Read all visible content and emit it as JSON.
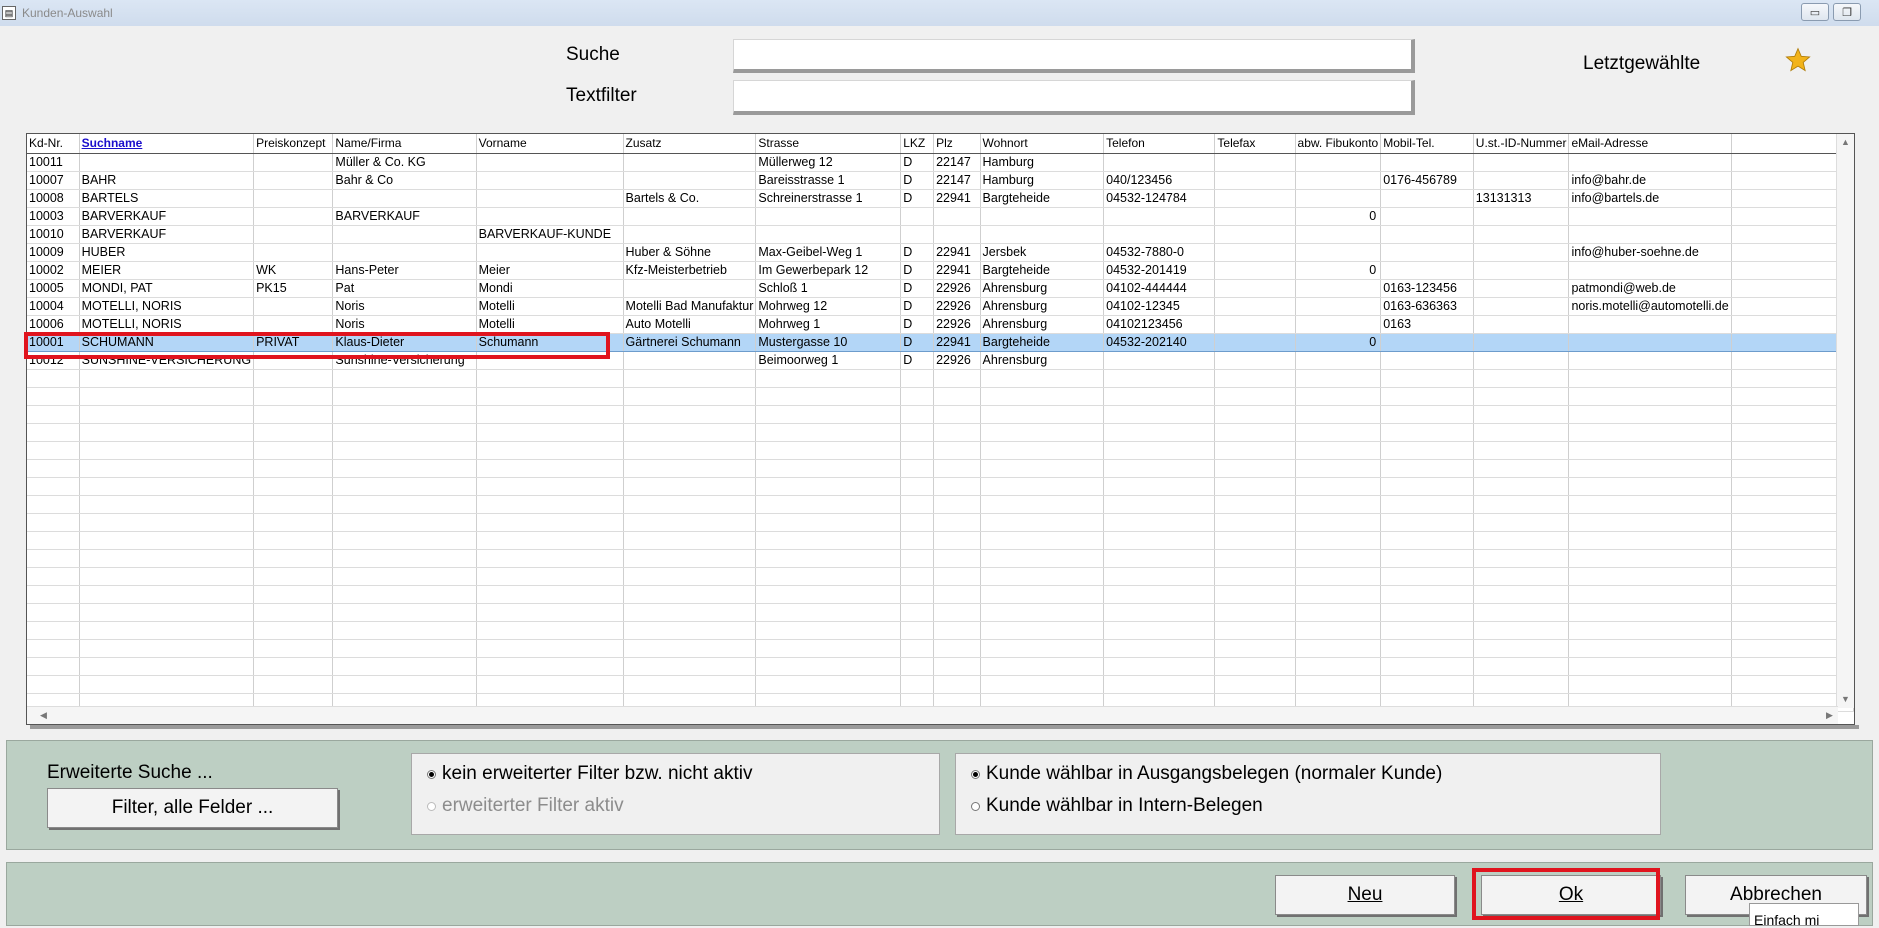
{
  "window": {
    "title": "Kunden-Auswahl"
  },
  "search": {
    "label": "Suche",
    "value": ""
  },
  "textfilter": {
    "label": "Textfilter",
    "value": ""
  },
  "recent": {
    "label": "Letztgewählte"
  },
  "grid": {
    "columns": [
      "Kd-Nr.",
      "Suchname",
      "Preiskonzept",
      "Name/Firma",
      "Vorname",
      "Zusatz",
      "Strasse",
      "LKZ",
      "Plz",
      "Wohnort",
      "Telefon",
      "Telefax",
      "abw. Fibukonto",
      "Mobil-Tel.",
      "U.st.-ID-Nummer",
      "eMail-Adresse",
      ""
    ],
    "sorted_column": "Suchname",
    "selected_row": "10001",
    "rows": [
      [
        "10011",
        "",
        "",
        "Müller & Co. KG",
        "",
        "",
        "Müllerweg 12",
        "D",
        "22147",
        "Hamburg",
        "",
        "",
        "",
        "",
        "",
        "",
        ""
      ],
      [
        "10007",
        "BAHR",
        "",
        "Bahr & Co",
        "",
        "",
        "Bareisstrasse 1",
        "D",
        "22147",
        "Hamburg",
        "040/123456",
        "",
        "",
        "0176-456789",
        "",
        "info@bahr.de",
        ""
      ],
      [
        "10008",
        "BARTELS",
        "",
        "",
        "",
        "Bartels & Co.",
        "Schreinerstrasse 1",
        "D",
        "22941",
        "Bargteheide",
        "04532-124784",
        "",
        "",
        "",
        "13131313",
        "info@bartels.de",
        ""
      ],
      [
        "10003",
        "BARVERKAUF",
        "",
        "BARVERKAUF",
        "",
        "",
        "",
        "",
        "",
        "",
        "",
        "",
        "0",
        "",
        "",
        "",
        ""
      ],
      [
        "10010",
        "BARVERKAUF",
        "",
        "",
        "BARVERKAUF-KUNDE",
        "",
        "",
        "",
        "",
        "",
        "",
        "",
        "",
        "",
        "",
        "",
        ""
      ],
      [
        "10009",
        "HUBER",
        "",
        "",
        "",
        "Huber & Söhne",
        "Max-Geibel-Weg 1",
        "D",
        "22941",
        "Jersbek",
        "04532-7880-0",
        "",
        "",
        "",
        "",
        "info@huber-soehne.de",
        ""
      ],
      [
        "10002",
        "MEIER",
        "WK",
        "Hans-Peter",
        "Meier",
        "Kfz-Meisterbetrieb",
        "Im Gewerbepark 12",
        "D",
        "22941",
        "Bargteheide",
        "04532-201419",
        "",
        "0",
        "",
        "",
        "",
        ""
      ],
      [
        "10005",
        "MONDI, PAT",
        "PK15",
        "Pat",
        "Mondi",
        "",
        "Schloß 1",
        "D",
        "22926",
        "Ahrensburg",
        "04102-444444",
        "",
        "",
        "0163-123456",
        "",
        "patmondi@web.de",
        ""
      ],
      [
        "10004",
        "MOTELLI, NORIS",
        "",
        "Noris",
        "Motelli",
        "Motelli Bad Manufaktur",
        "Mohrweg 12",
        "D",
        "22926",
        "Ahrensburg",
        "04102-12345",
        "",
        "",
        "0163-636363",
        "",
        "noris.motelli@automotelli.de",
        ""
      ],
      [
        "10006",
        "MOTELLI, NORIS",
        "",
        "Noris",
        "Motelli",
        "Auto Motelli",
        "Mohrweg 1",
        "D",
        "22926",
        "Ahrensburg",
        "04102123456",
        "",
        "",
        "0163",
        "",
        "",
        ""
      ],
      [
        "10001",
        "SCHUMANN",
        "PRIVAT",
        "Klaus-Dieter",
        "Schumann",
        "Gärtnerei Schumann",
        "Mustergasse 10",
        "D",
        "22941",
        "Bargteheide",
        "04532-202140",
        "",
        "0",
        "",
        "",
        "",
        ""
      ],
      [
        "10012",
        "SUNSHINE-VERSICHERUNG",
        "",
        "Sunshine-Versicherung",
        "",
        "",
        "Beimoorweg 1",
        "D",
        "22926",
        "Ahrensburg",
        "",
        "",
        "",
        "",
        "",
        "",
        ""
      ]
    ],
    "empty_rows": 19
  },
  "extended": {
    "title": "Erweiterte Suche ...",
    "filter_button": "Filter, alle Felder ...",
    "filter_options": [
      {
        "label": "kein erweiterter Filter bzw. nicht aktiv",
        "checked": true,
        "enabled": true
      },
      {
        "label": "erweiterter Filter aktiv",
        "checked": false,
        "enabled": false
      }
    ],
    "customer_options": [
      {
        "label": "Kunde wählbar in Ausgangsbelegen (normaler Kunde)",
        "checked": true
      },
      {
        "label": "Kunde wählbar in Intern-Belegen",
        "checked": false
      }
    ]
  },
  "buttons": {
    "new": "Neu",
    "ok": "Ok",
    "cancel": "Abbrechen"
  },
  "tooltip": {
    "text": "Einfach mi"
  },
  "colors": {
    "selection": "#b3d6f7",
    "panel": "#bdcfc3",
    "highlight": "#e0141e",
    "star": "#f2b31a",
    "sortlink": "#1a0dcc"
  }
}
